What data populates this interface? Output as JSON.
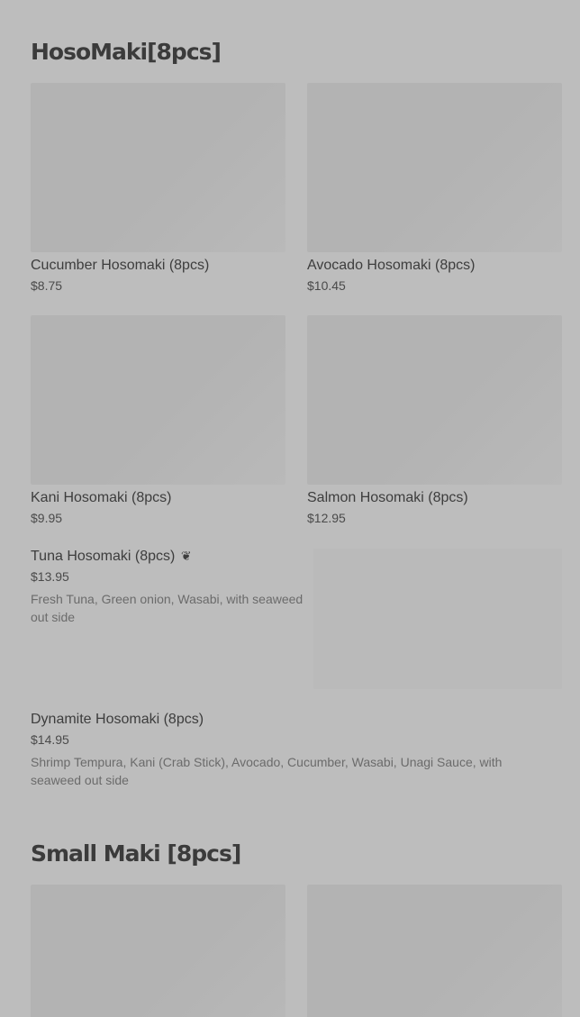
{
  "sections": [
    {
      "title": "HosoMaki[8pcs]",
      "grid_items": [
        {
          "name": "Cucumber Hosomaki (8pcs)",
          "price": "$8.75"
        },
        {
          "name": "Avocado Hosomaki (8pcs)",
          "price": "$10.45"
        },
        {
          "name": "Kani Hosomaki (8pcs)",
          "price": "$9.95"
        },
        {
          "name": "Salmon Hosomaki (8pcs)",
          "price": "$12.95"
        }
      ],
      "list_items": [
        {
          "name": "Tuna Hosomaki (8pcs)",
          "icon": "vegetarian-leaf-icon",
          "price": "$13.95",
          "description": "Fresh Tuna, Green onion, Wasabi, with seaweed out side"
        },
        {
          "name": "Dynamite Hosomaki (8pcs)",
          "price": "$14.95",
          "description": "Shrimp Tempura, Kani (Crab Stick), Avocado, Cucumber, Wasabi, Unagi Sauce, with seaweed out side"
        }
      ]
    },
    {
      "title": "Small Maki [8pcs]"
    }
  ]
}
